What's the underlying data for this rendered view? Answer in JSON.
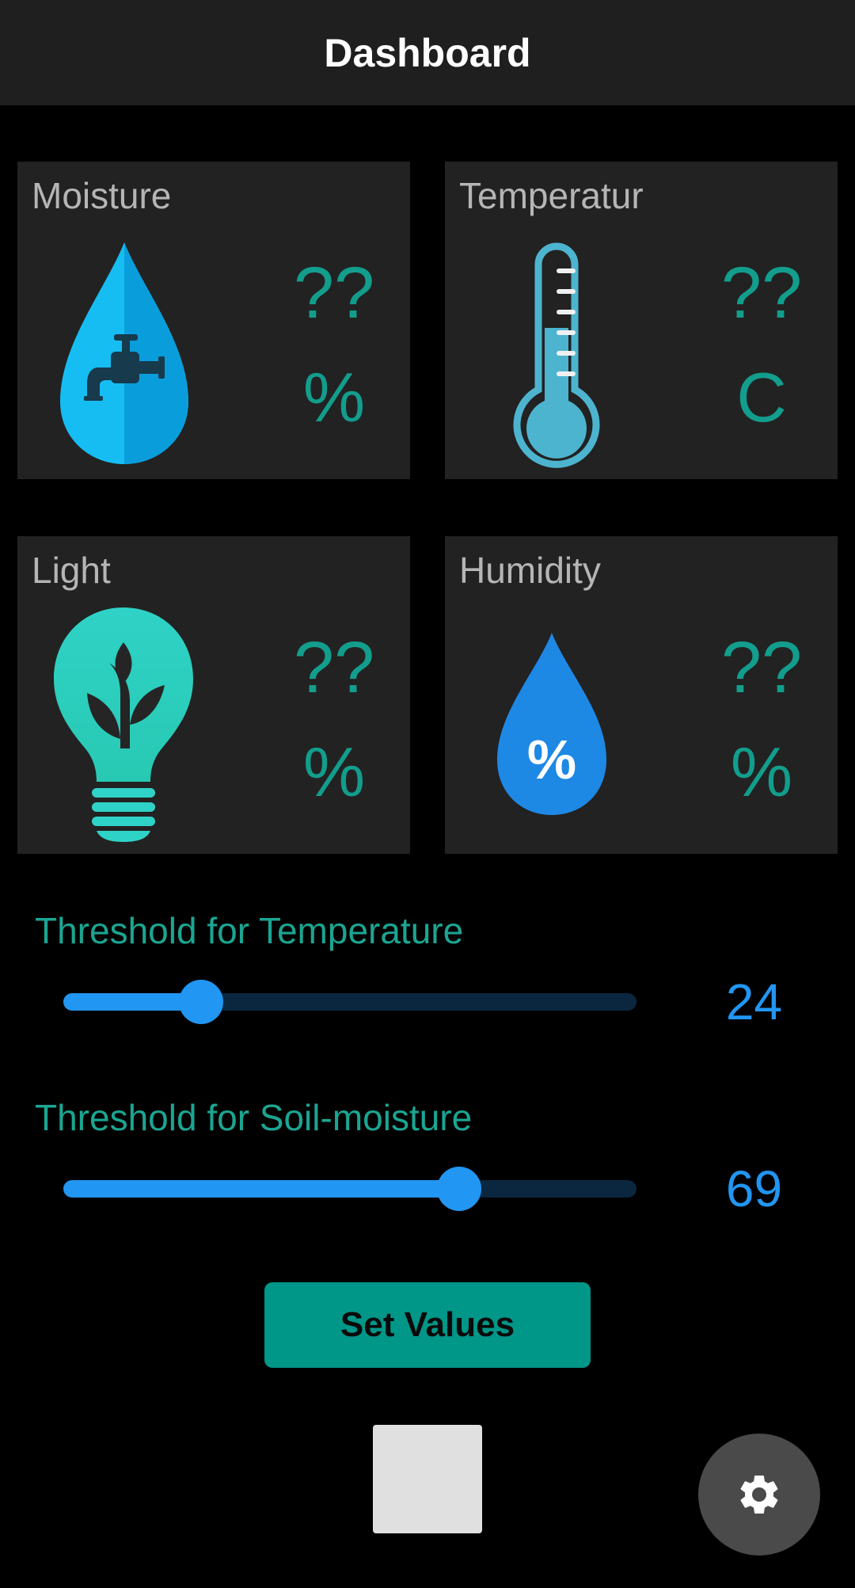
{
  "appbar": {
    "title": "Dashboard"
  },
  "cards": [
    {
      "label": "Moisture",
      "value": "??",
      "unit": "%",
      "icon": "faucet-drop-icon"
    },
    {
      "label": "Temperatur",
      "value": "??",
      "unit": "C",
      "icon": "thermometer-icon"
    },
    {
      "label": "Light",
      "value": "??",
      "unit": "%",
      "icon": "plant-bulb-icon"
    },
    {
      "label": "Humidity",
      "value": "??",
      "unit": "%",
      "icon": "humidity-drop-icon"
    }
  ],
  "icons": {
    "humidity_glyph": "%"
  },
  "thresholds": [
    {
      "label": "Threshold for Temperature",
      "value": "24",
      "fraction": 0.24
    },
    {
      "label": "Threshold for Soil-moisture",
      "value": "69",
      "fraction": 0.69
    }
  ],
  "set_button": {
    "label": "Set Values"
  },
  "fab": {
    "icon": "gear-icon"
  },
  "colors": {
    "accent_teal": "#129d8c",
    "slider_blue": "#2196f3",
    "button_teal": "#009688",
    "card_bg": "#222222"
  }
}
